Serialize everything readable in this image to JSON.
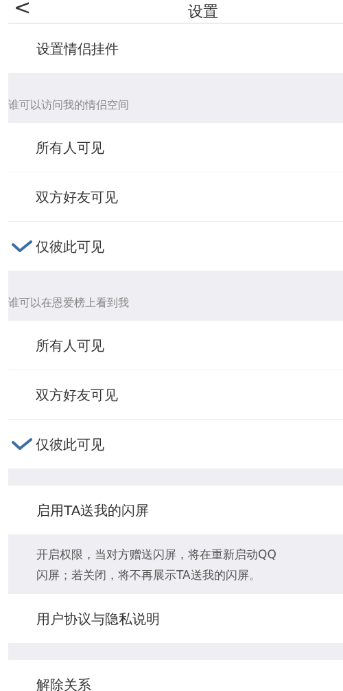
{
  "nav": {
    "back": "<",
    "title": "设置"
  },
  "items": [
    {
      "kind": "row",
      "label": "设置情侣挂件"
    },
    {
      "kind": "header",
      "label": "谁可以访问我的情侣空间"
    },
    {
      "kind": "option",
      "label": "所有人可见",
      "selected": false
    },
    {
      "kind": "option",
      "label": "双方好友可见",
      "selected": false
    },
    {
      "kind": "option",
      "label": "仅彼此可见",
      "selected": true
    },
    {
      "kind": "header",
      "label": "谁可以在恩爱榜上看到我"
    },
    {
      "kind": "option",
      "label": "所有人可见",
      "selected": false
    },
    {
      "kind": "option",
      "label": "双方好友可见",
      "selected": false
    },
    {
      "kind": "option",
      "label": "仅彼此可见",
      "selected": true
    },
    {
      "kind": "spacer"
    },
    {
      "kind": "row",
      "label": "启用TA送我的闪屏"
    },
    {
      "kind": "note",
      "lines": [
        "开启权限，当对方赠送闪屏，将在重新启动QQ",
        "闪屏；若关闭，将不再展示TA送我的闪屏。"
      ]
    },
    {
      "kind": "row",
      "label": "用户协议与隐私说明"
    },
    {
      "kind": "spacer"
    },
    {
      "kind": "row",
      "label": "解除关系"
    }
  ]
}
